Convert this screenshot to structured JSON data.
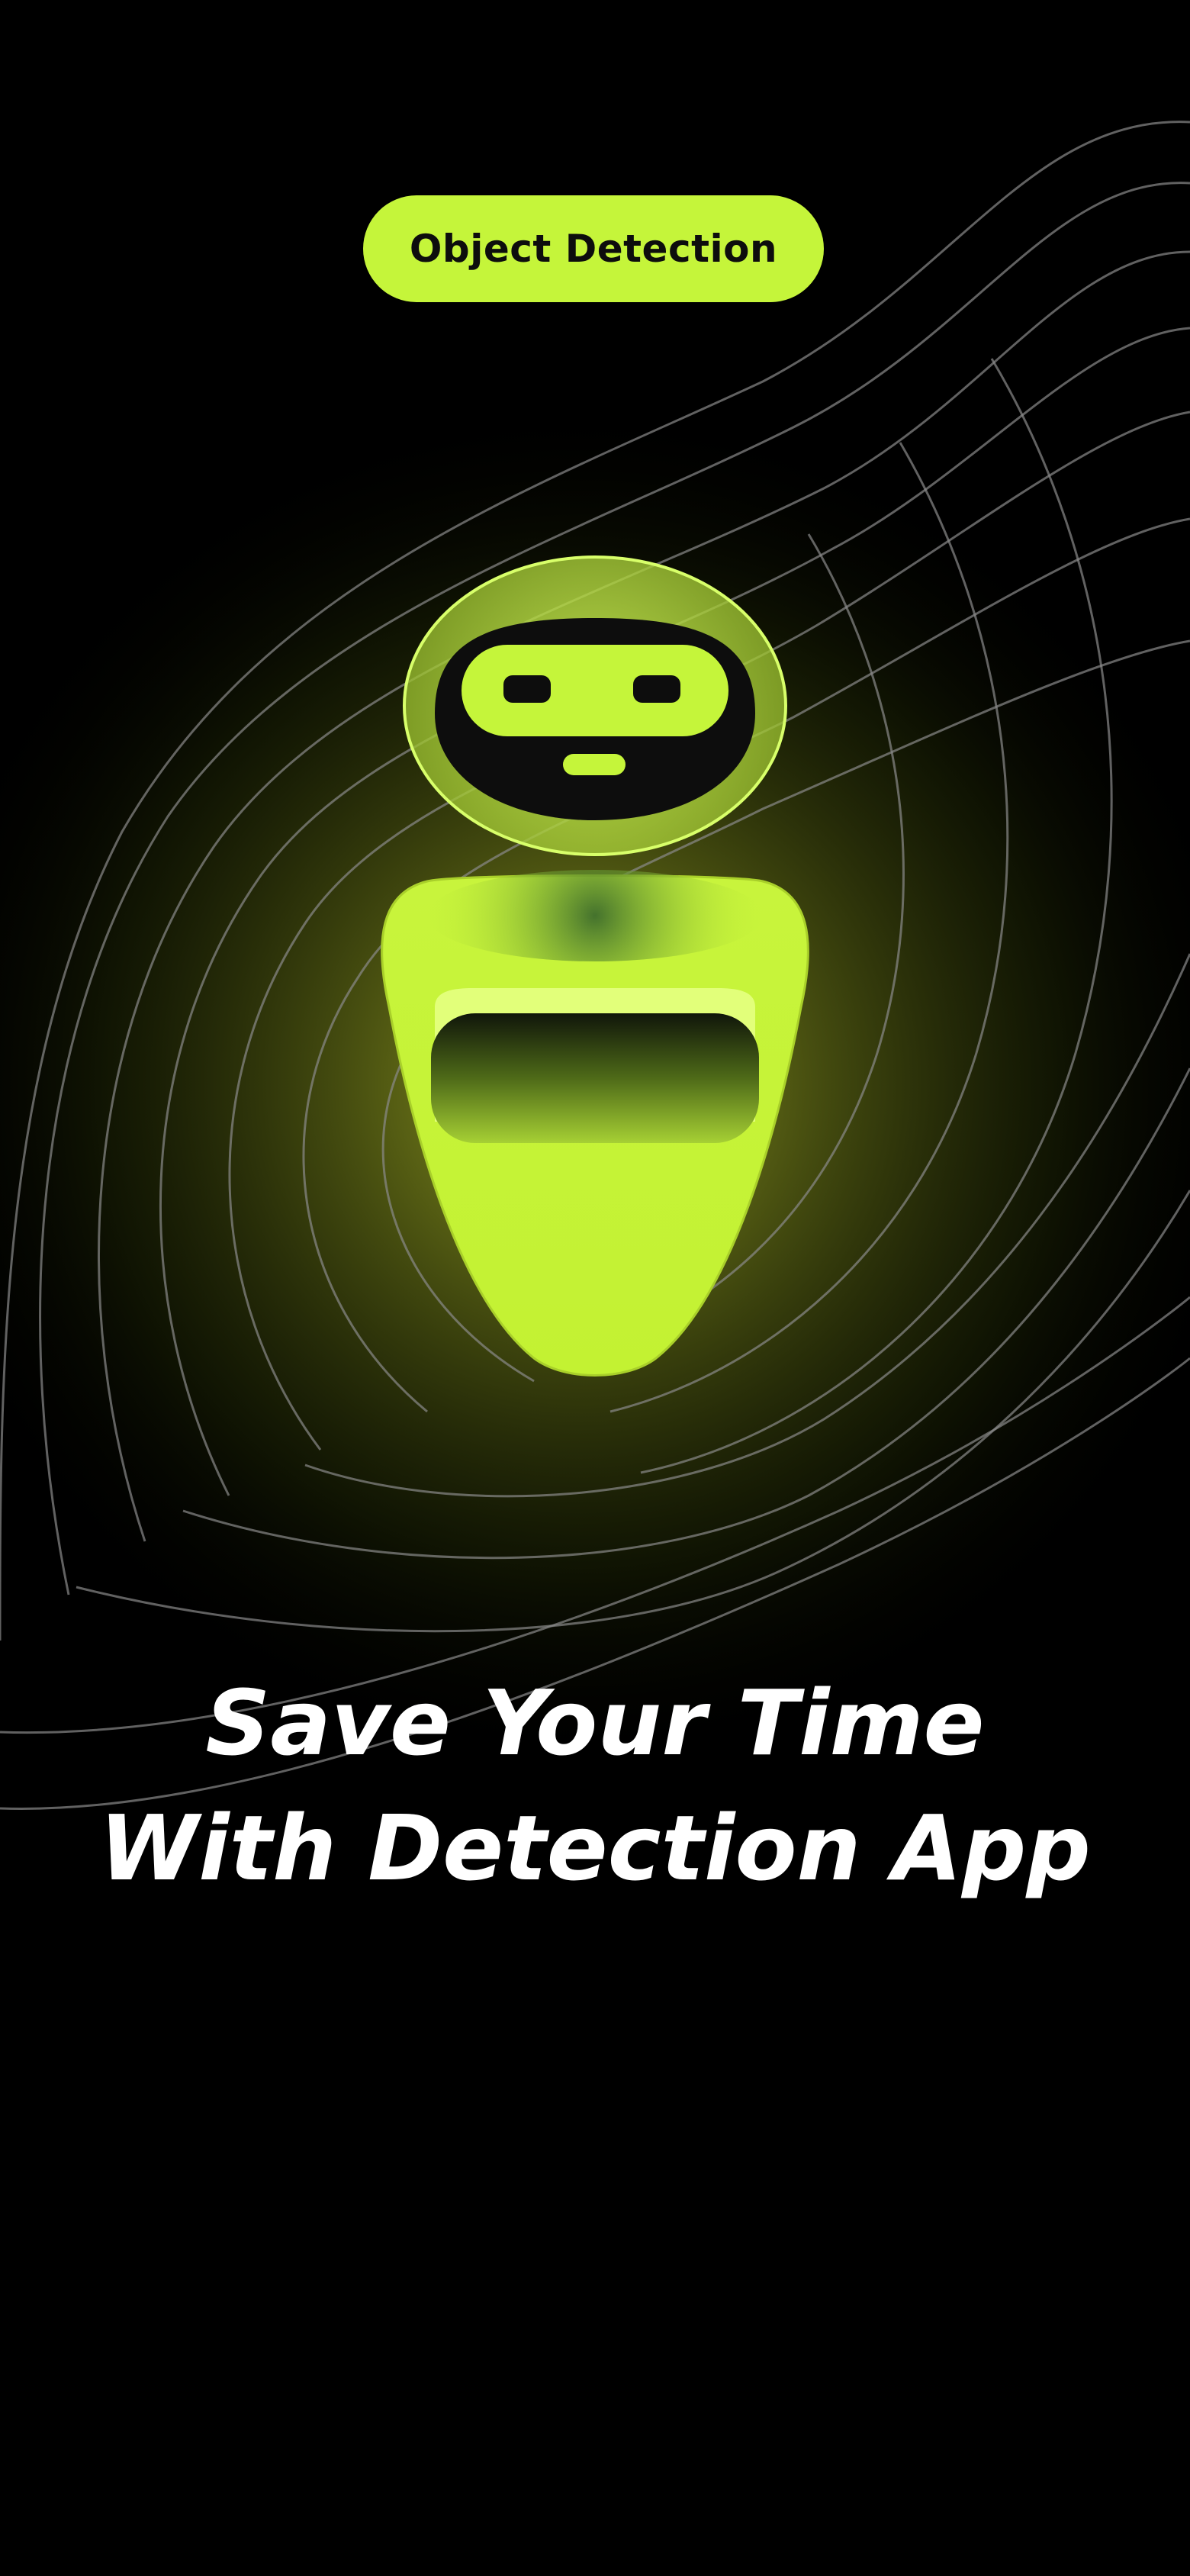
{
  "badge": {
    "label": "Object Detection"
  },
  "headline": {
    "line1": "Save Your Time",
    "line2": "With Detection App"
  },
  "illustration": {
    "icon": "robot-icon",
    "background": "contour-lines"
  },
  "colors": {
    "accent": "#c5f53a",
    "background": "#000000",
    "text": "#ffffff",
    "badge_text": "#0d0d0d"
  }
}
